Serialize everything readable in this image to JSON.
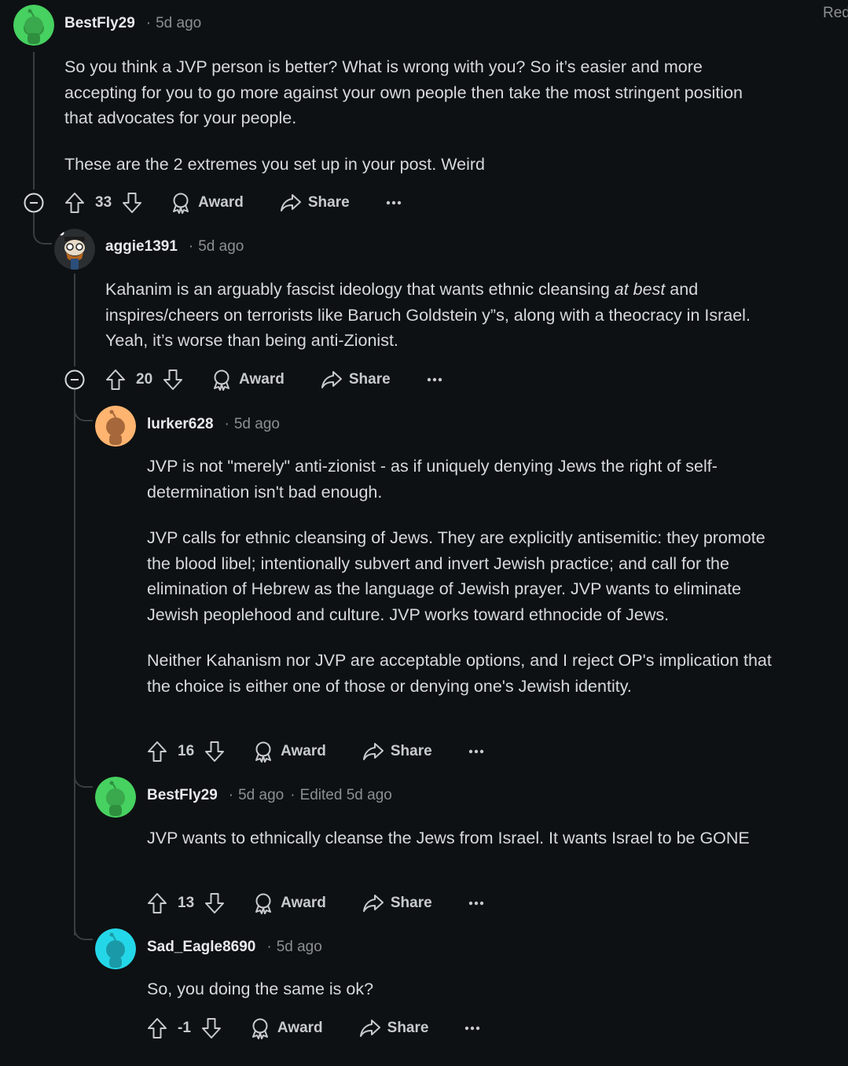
{
  "corner_text": "Red",
  "comments": [
    {
      "username": "BestFly29",
      "time": "5d ago",
      "paragraphs": [
        "So you think a JVP person is better? What is wrong with you? So it’s easier and more accepting for you to go more against your own people then take the most stringent position that advocates for your people.",
        "These are the 2 extremes you set up in your post. Weird"
      ],
      "votes": "33",
      "award_label": "Award",
      "share_label": "Share"
    },
    {
      "username": "aggie1391",
      "time": "5d ago",
      "body_before": "Kahanim is an arguably fascist ideology that wants ethnic cleansing ",
      "body_emphasis": "at best",
      "body_after": " and inspires/cheers on terrorists like Baruch Goldstein y”s, along with a theocracy in Israel. Yeah, it’s worse than being anti-Zionist.",
      "votes": "20",
      "award_label": "Award",
      "share_label": "Share"
    },
    {
      "username": "lurker628",
      "time": "5d ago",
      "paragraphs": [
        "JVP is not \"merely\" anti-zionist - as if uniquely denying Jews the right of self-determination isn't bad enough.",
        "JVP calls for ethnic cleansing of Jews. They are explicitly antisemitic: they promote the blood libel; intentionally subvert and invert Jewish practice; and call for the elimination of Hebrew as the language of Jewish prayer. JVP wants to eliminate Jewish peoplehood and culture. JVP works toward ethnocide of Jews.",
        "Neither Kahanism nor JVP are acceptable options, and I reject OP's implication that the choice is either one of those or denying one's Jewish identity."
      ],
      "votes": "16",
      "award_label": "Award",
      "share_label": "Share"
    },
    {
      "username": "BestFly29",
      "time": "5d ago",
      "edited": "Edited 5d ago",
      "paragraphs": [
        "JVP wants to ethnically cleanse the Jews from Israel. It wants Israel to be GONE"
      ],
      "votes": "13",
      "award_label": "Award",
      "share_label": "Share"
    },
    {
      "username": "Sad_Eagle8690",
      "time": "5d ago",
      "paragraphs": [
        "So, you doing the same is ok?"
      ],
      "votes": "-1",
      "award_label": "Award",
      "share_label": "Share"
    }
  ],
  "colors": {
    "background": "#0e1113",
    "avatar_green": "#46d160",
    "avatar_orange": "#ffb470",
    "avatar_cyan": "#24d7e8",
    "thread_line": "#3a3e42"
  },
  "icons": [
    "upvote-icon",
    "downvote-icon",
    "award-icon",
    "share-icon",
    "more-icon",
    "collapse-icon",
    "snoo-avatar-icon"
  ]
}
